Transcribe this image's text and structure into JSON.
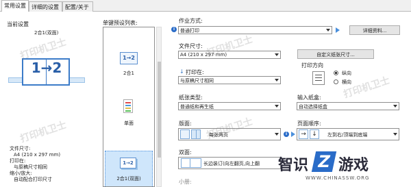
{
  "tabs": [
    "常用设置",
    "详细的设置",
    "配置/关于"
  ],
  "left": {
    "current_label": "当前设置",
    "current_name": "2合1(双面)",
    "diagram_text": "1→2",
    "info_lines": [
      "文件尺寸:",
      "A4 (210 x 297 mm)",
      "打印在:",
      "与原稿尺寸相同",
      "缩小/放大:",
      "自动配合打印尺寸"
    ]
  },
  "presets": {
    "label": "单键预设列表:",
    "items": [
      {
        "icon_text": "1→2",
        "caption": "2合1"
      },
      {
        "icon_text": "",
        "caption": "单面"
      },
      {
        "icon_text": "1→2",
        "caption": "2合1(双面)"
      }
    ]
  },
  "job": {
    "label": "作业方式:",
    "value": "普通打印",
    "details_button": "详细资料..."
  },
  "paper_size": {
    "label": "文件尺寸:",
    "value": "A4 (210 x 297 mm)",
    "custom_button": "自定义纸张尺寸..."
  },
  "print_on": {
    "label": "打印在:",
    "value": "与原稿尺寸相同"
  },
  "orientation": {
    "label": "打印方向",
    "options": [
      "纵向",
      "横向"
    ],
    "selected": "纵向"
  },
  "paper_type": {
    "label": "纸张类型:",
    "value": "普通纸和再生纸"
  },
  "input_tray": {
    "label": "输入纸盒:",
    "value": "自动选择纸盒"
  },
  "layout": {
    "label": "版面:",
    "value": "每张两页"
  },
  "page_order": {
    "label": "页面顺序:",
    "value": "左到右/顶端到底端"
  },
  "duplex": {
    "label": "双面:",
    "value": "长边装订(向左翻页,向上翻"
  },
  "booklet": {
    "label": "小册:"
  },
  "watermarks": [
    "打印机卫士",
    "打印机卫士",
    "打印机卫士",
    "打印机卫士",
    "打印机卫士"
  ],
  "brand": {
    "text_a": "智识",
    "text_b": "游戏",
    "url": "WWW.CHINASSW.ORG"
  }
}
